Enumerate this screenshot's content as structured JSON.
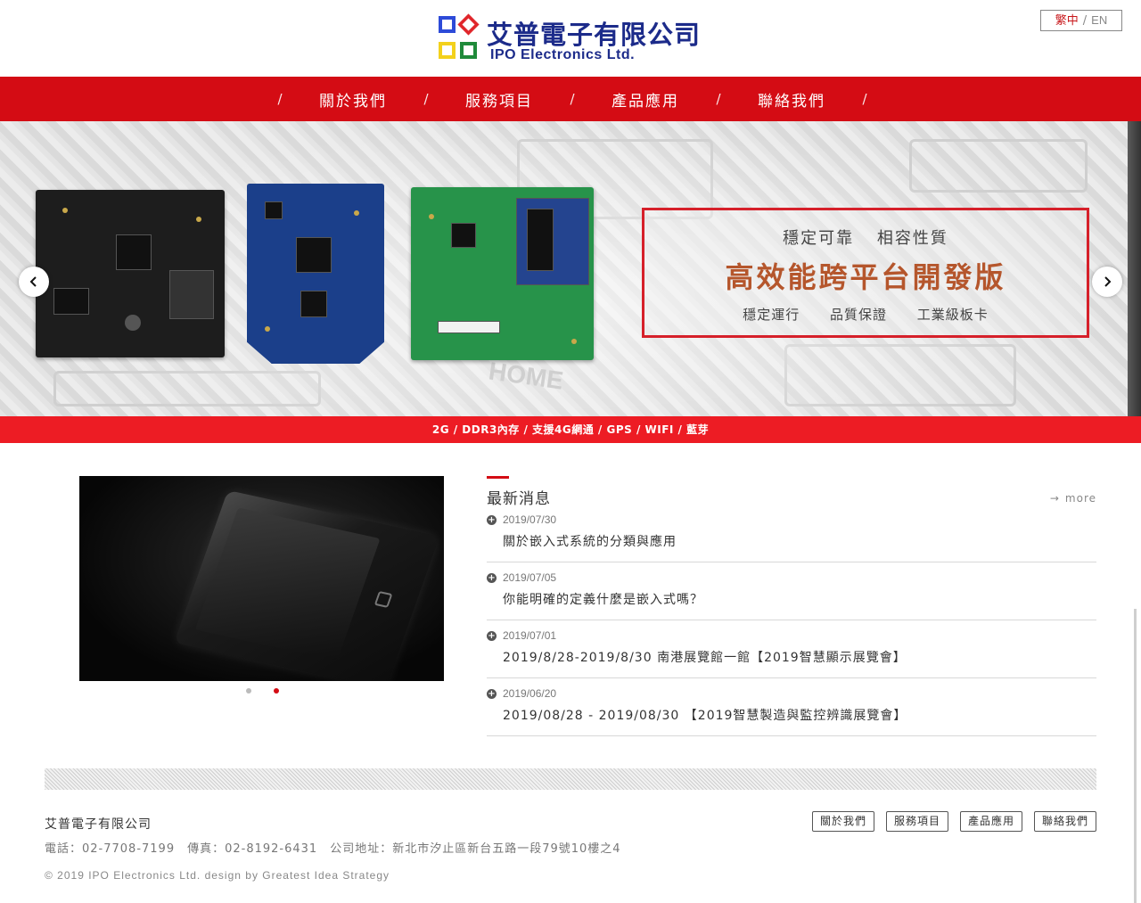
{
  "brand": {
    "name_cn": "艾普電子有限公司",
    "name_en": "IPO Electronics Ltd.",
    "logo_colors": [
      "#2d4bd8",
      "#e0262b",
      "#f3d11c",
      "#1f8a3a"
    ]
  },
  "lang": {
    "zh": "繁中",
    "sep": "/",
    "en": "EN"
  },
  "nav": {
    "separator": "/",
    "items": [
      "關於我們",
      "服務項目",
      "產品應用",
      "聯絡我們"
    ]
  },
  "hero": {
    "watermark": "HOME",
    "promo_top": "穩定可靠 相容性質",
    "promo_main": "高效能跨平台開發版",
    "promo_bottom": "穩定運行 品質保證 工業級板卡",
    "strip": "2G / DDR3內存 / 支援4G網通 / GPS / WIFI / 藍芽",
    "prev_icon": "chevron-left-icon",
    "next_icon": "chevron-right-icon"
  },
  "slideshow": {
    "dot_count": 2,
    "active_dot": 1
  },
  "news": {
    "title": "最新消息",
    "more": "more",
    "items": [
      {
        "date": "2019/07/30",
        "title": "關於嵌入式系統的分類與應用"
      },
      {
        "date": "2019/07/05",
        "title": "你能明確的定義什麼是嵌入式嗎？"
      },
      {
        "date": "2019/07/01",
        "title": "2019/8/28-2019/8/30 南港展覽館一館【2019智慧顯示展覽會】"
      },
      {
        "date": "2019/06/20",
        "title": "2019/08/28 - 2019/08/30 【2019智慧製造與監控辨識展覽會】"
      }
    ]
  },
  "footer": {
    "company": "艾普電子有限公司",
    "phone": "電話：02-7708-7199",
    "fax": "傳真：02-8192-6431",
    "address": "公司地址：新北市汐止區新台五路一段79號10樓之4",
    "copyright": "© 2019 IPO Electronics Ltd. design by Greatest Idea Strategy",
    "links": [
      "關於我們",
      "服務項目",
      "產品應用",
      "聯絡我們"
    ]
  },
  "colors": {
    "nav_red": "#d40c14",
    "strip_red": "#ed1c24",
    "brand_blue": "#1c2b8a",
    "promo_text": "#b5562c"
  }
}
